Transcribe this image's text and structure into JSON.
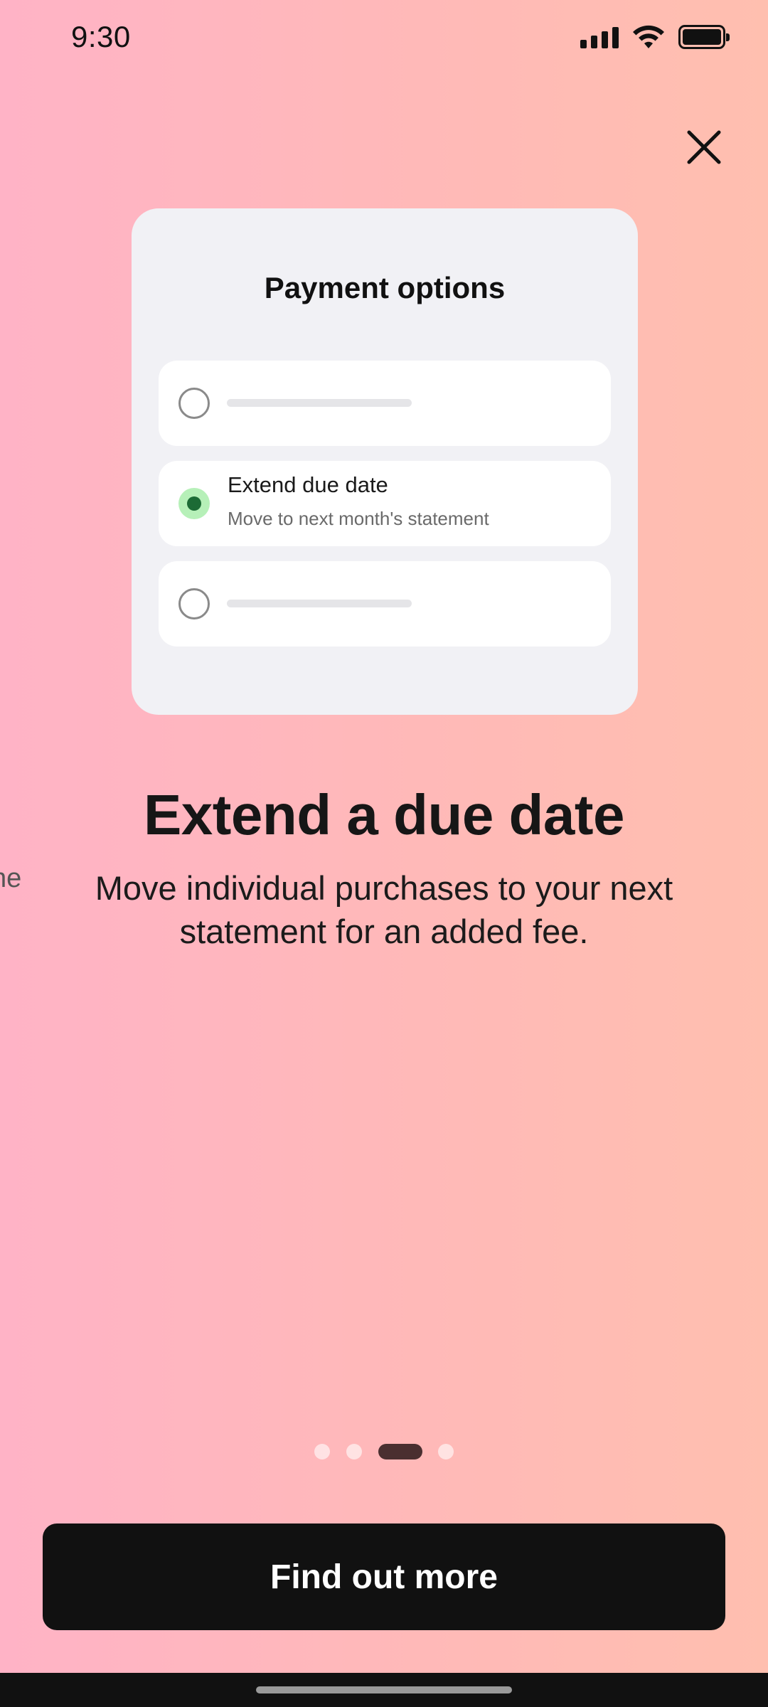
{
  "status_bar": {
    "time": "9:30",
    "icons": [
      "signal-icon",
      "wifi-icon",
      "battery-icon"
    ]
  },
  "close": {
    "icon": "close-icon"
  },
  "card": {
    "title": "Payment options",
    "options": [
      {
        "selected": false,
        "placeholder": true
      },
      {
        "selected": true,
        "title": "Extend due date",
        "subtitle": "Move to next month's statement"
      },
      {
        "selected": false,
        "placeholder": true
      }
    ]
  },
  "headline": "Extend a due date",
  "body": "Move individual purchases to your next statement for an added fee.",
  "peek_text": "ne",
  "pager": {
    "count": 4,
    "active_index": 2
  },
  "cta": {
    "label": "Find out more"
  },
  "colors": {
    "background_start": "#ffb3c6",
    "background_end": "#ffbfaf",
    "selected_radio_fill": "#b6f0b8",
    "selected_radio_dot": "#1c6b35",
    "pager_active": "#4a2f30",
    "cta_background": "#111111"
  }
}
